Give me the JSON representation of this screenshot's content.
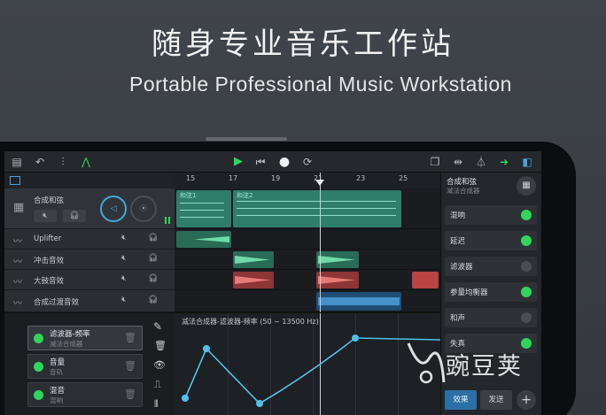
{
  "headline": {
    "chinese": "随身专业音乐工作站",
    "english": "Portable Professional Music Workstation"
  },
  "toolbar": {
    "icons": [
      "sidebar-icon",
      "undo-icon",
      "mixer-icon",
      "automation-icon",
      "play-icon",
      "skip-back-icon",
      "record-icon",
      "loop-icon",
      "copy-icon",
      "split-icon",
      "metronome-icon",
      "export-icon",
      "panel-icon"
    ]
  },
  "ruler": {
    "marks": [
      "15",
      "17",
      "19",
      "21",
      "23",
      "25"
    ]
  },
  "tracks": [
    {
      "name": "合成和弦",
      "clip1": "和弦1",
      "clip2": "和弦2"
    },
    {
      "name": "Uplifter"
    },
    {
      "name": "冲击音效"
    },
    {
      "name": "大鼓音效"
    },
    {
      "name": "合成过渡音效"
    }
  ],
  "right_panel": {
    "title": "合成和弦",
    "subtitle": "减法合成器",
    "effects": [
      {
        "label": "混响",
        "on": true
      },
      {
        "label": "延迟",
        "on": true
      },
      {
        "label": "滤波器",
        "on": false
      },
      {
        "label": "参量均衡器",
        "on": true
      },
      {
        "label": "和声",
        "on": false
      },
      {
        "label": "失真",
        "on": true
      }
    ],
    "effects_button": "效果",
    "send_button": "发送",
    "add_button": "+"
  },
  "automation": {
    "title": "减法合成器-滤波器-频率  (50 ~ 13500 Hz)",
    "params": [
      {
        "name": "滤波器-频率",
        "sub": "减法合成器"
      },
      {
        "name": "音量",
        "sub": "音轨"
      },
      {
        "name": "混音",
        "sub": "混响"
      }
    ]
  },
  "watermark": "豌豆荚",
  "colors": {
    "accent_green": "#2fd65b",
    "clip_teal": "#2f7d6b",
    "clip_red": "#b84444",
    "clip_blue": "#2c6fa6",
    "curve": "#4fc3e8"
  }
}
